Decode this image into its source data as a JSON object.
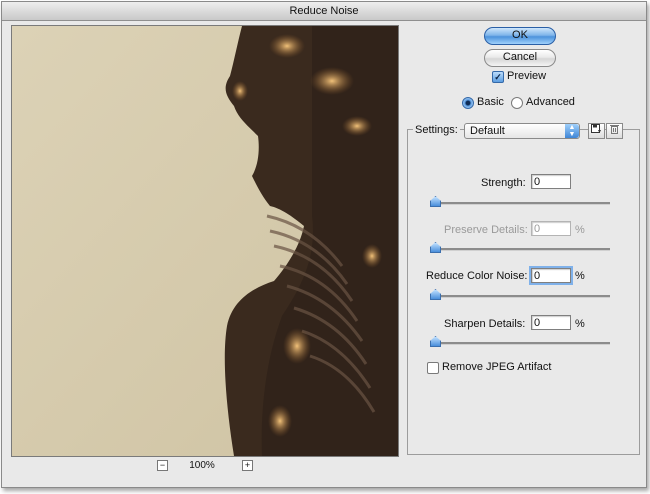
{
  "window": {
    "title": "Reduce Noise"
  },
  "buttons": {
    "ok": "OK",
    "cancel": "Cancel"
  },
  "preview": {
    "label": "Preview",
    "checked": true
  },
  "mode": {
    "basic": "Basic",
    "advanced": "Advanced",
    "selected": "basic"
  },
  "settings": {
    "label": "Settings:",
    "value": "Default"
  },
  "controls": {
    "strength": {
      "label": "Strength:",
      "value": "0",
      "level": 0
    },
    "preserve_details": {
      "label": "Preserve Details:",
      "value": "0",
      "unit": "%",
      "level": 0,
      "disabled": true
    },
    "reduce_color_noise": {
      "label": "Reduce Color Noise:",
      "value": "0",
      "unit": "%",
      "level": 0
    },
    "sharpen_details": {
      "label": "Sharpen Details:",
      "value": "0",
      "unit": "%",
      "level": 0
    }
  },
  "jpeg": {
    "label": "Remove JPEG Artifact",
    "checked": false
  },
  "zoom": {
    "value": "100%",
    "minus": "−",
    "plus": "+"
  },
  "icons": {
    "save_settings": "save-disk-icon",
    "delete_settings": "trash-icon",
    "select_arrows": "up-down-arrows-icon"
  },
  "colors": {
    "accent": "#4d93dc",
    "dialog_bg": "#e9e9e9",
    "image_bg": "#d7cdb2",
    "statue": "#3a2a1e"
  }
}
